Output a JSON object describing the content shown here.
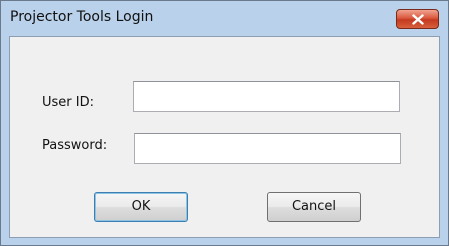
{
  "window": {
    "title": "Projector Tools Login"
  },
  "form": {
    "user_id_label": "User ID:",
    "user_id_value": "",
    "password_label": "Password:",
    "password_value": ""
  },
  "buttons": {
    "ok_label": "OK",
    "cancel_label": "Cancel"
  },
  "icons": {
    "close": "close-icon"
  },
  "colors": {
    "frame": "#b9d1ea",
    "close_button": "#c43a1f",
    "client": "#f0f0f0"
  }
}
